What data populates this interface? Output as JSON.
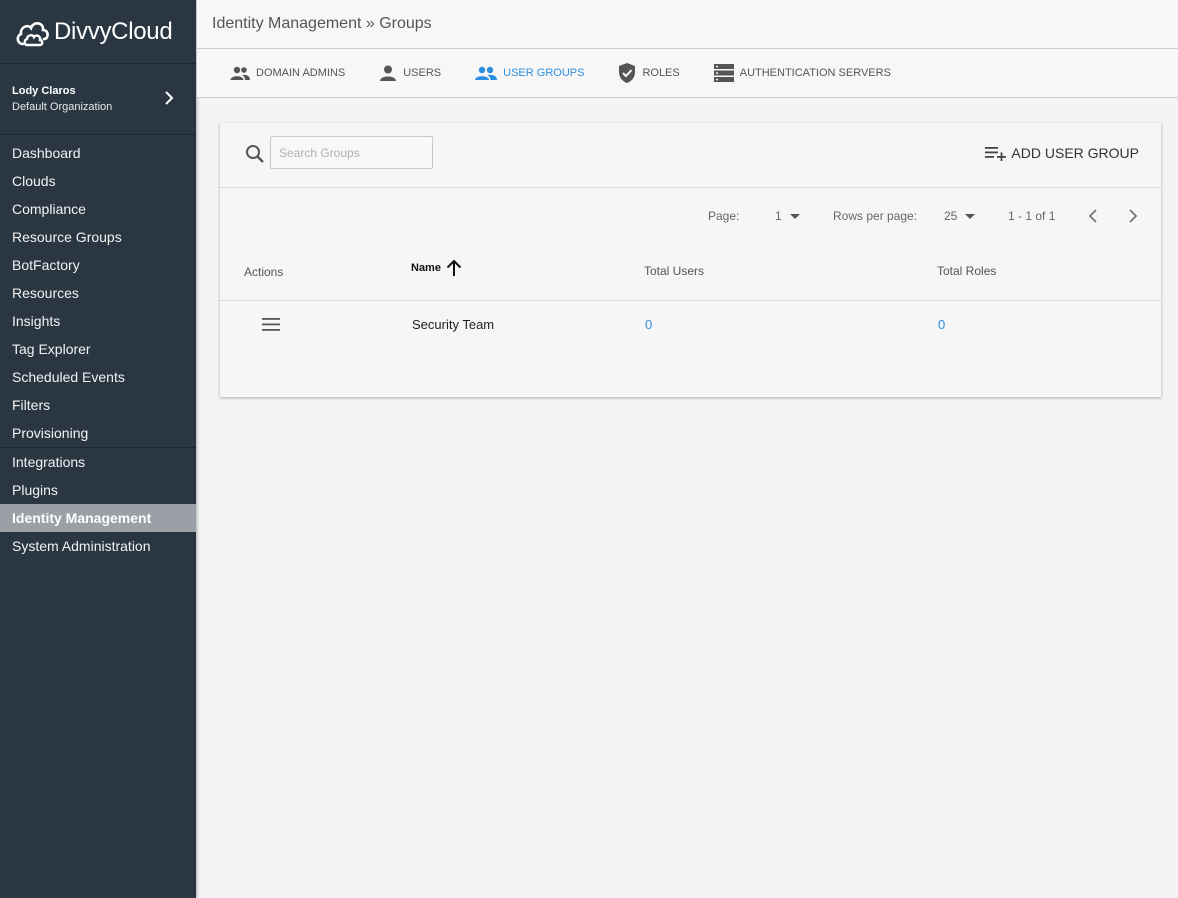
{
  "app": {
    "logo_text": "DivvyCloud"
  },
  "user": {
    "name": "Lody Claros",
    "organization": "Default Organization"
  },
  "nav": [
    {
      "label": "Dashboard"
    },
    {
      "label": "Clouds"
    },
    {
      "label": "Compliance"
    },
    {
      "label": "Resource Groups"
    },
    {
      "label": "BotFactory"
    },
    {
      "label": "Resources"
    },
    {
      "label": "Insights"
    },
    {
      "label": "Tag Explorer"
    },
    {
      "label": "Scheduled Events"
    },
    {
      "label": "Filters"
    },
    {
      "label": "Provisioning"
    },
    {
      "label": "Integrations"
    },
    {
      "label": "Plugins"
    },
    {
      "label": "Identity Management",
      "active": true
    },
    {
      "label": "System Administration"
    }
  ],
  "header": {
    "title": "Identity Management » Groups"
  },
  "tabs": [
    {
      "label": "DOMAIN ADMINS",
      "icon": "admins-icon"
    },
    {
      "label": "USERS",
      "icon": "user-icon"
    },
    {
      "label": "USER GROUPS",
      "icon": "group-icon",
      "active": true
    },
    {
      "label": "ROLES",
      "icon": "shield-icon"
    },
    {
      "label": "AUTHENTICATION SERVERS",
      "icon": "server-icon"
    }
  ],
  "search": {
    "placeholder": "Search Groups",
    "value": ""
  },
  "add_button": {
    "label": "ADD USER GROUP"
  },
  "pagination": {
    "page_label": "Page:",
    "page_value": "1",
    "rows_label": "Rows per page:",
    "rows_value": "25",
    "range": "1 - 1 of 1"
  },
  "table": {
    "columns": [
      "Actions",
      "Name",
      "Total Users",
      "Total Roles"
    ],
    "rows": [
      {
        "name": "Security Team",
        "total_users": "0",
        "total_roles": "0"
      }
    ]
  },
  "colors": {
    "accent": "#2d8fe0",
    "sidebar_bg": "#2a3642",
    "active_nav_bg": "#9aa0a6"
  }
}
